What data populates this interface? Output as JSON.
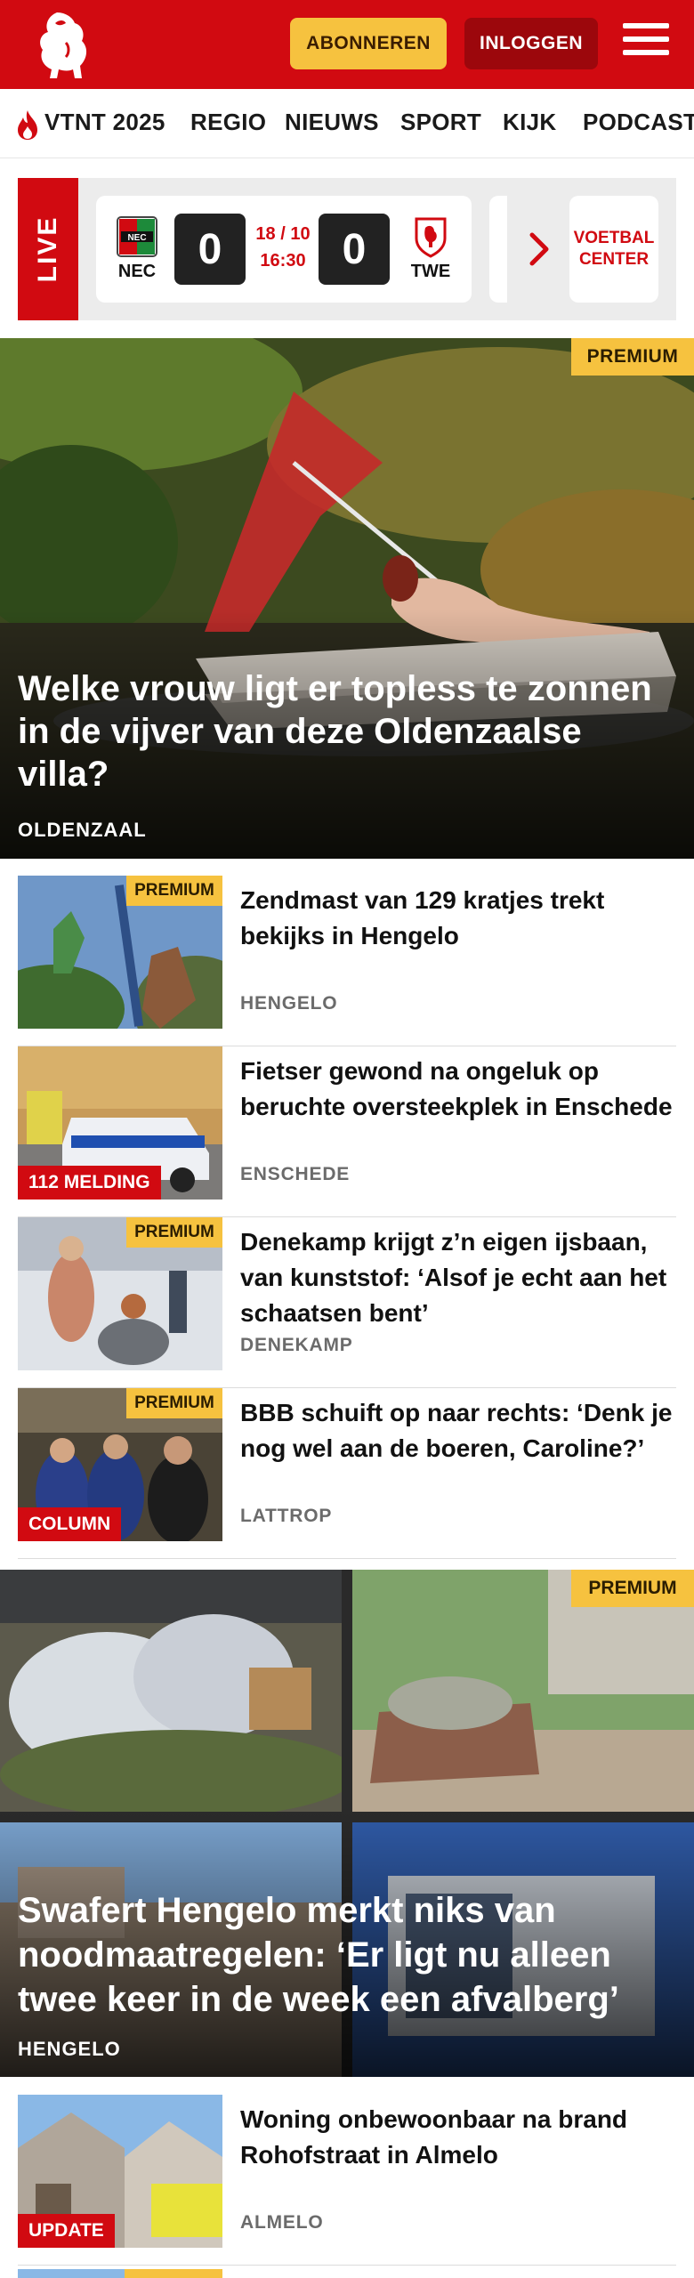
{
  "header": {
    "subscribe_label": "ABONNEREN",
    "login_label": "INLOGGEN",
    "brand_color": "#d10a11",
    "accent_color": "#f6c23f"
  },
  "nav": {
    "items": [
      "VTNT 2025",
      "REGIO",
      "NIEUWS",
      "SPORT",
      "KIJK",
      "PODCAST"
    ]
  },
  "live": {
    "label": "LIVE",
    "match": {
      "home": "NEC",
      "away": "TWE",
      "home_score": "0",
      "away_score": "0",
      "date": "18 / 10",
      "time": "16:30"
    },
    "voetbal_center_label": "VOETBAL CENTER"
  },
  "hero": {
    "badge": "PREMIUM",
    "title": "Welke vrouw ligt er topless te zonnen in de vijver van deze Oldenzaalse villa?",
    "location": "OLDENZAAL"
  },
  "articles": [
    {
      "title": "Zendmast van 129 kratjes trekt bekijks in Hengelo",
      "location": "HENGELO",
      "premium": "PREMIUM",
      "tag": ""
    },
    {
      "title": "Fietser gewond na ongeluk op beruchte oversteekplek in Enschede",
      "location": "ENSCHEDE",
      "premium": "",
      "tag": "112 MELDING"
    },
    {
      "title": "Denekamp krijgt z’n eigen ijsbaan, van kunststof: ‘Alsof je echt aan het schaatsen bent’",
      "location": "DENEKAMP",
      "premium": "PREMIUM",
      "tag": ""
    },
    {
      "title": "BBB schuift op naar rechts: ‘Denk je nog wel aan de boeren, Caroline?’",
      "location": "LATTROP",
      "premium": "PREMIUM",
      "tag": "COLUMN"
    }
  ],
  "double_hero": {
    "badge": "PREMIUM",
    "title": "Swafert Hengelo merkt niks van noodmaatregelen: ‘Er ligt nu alleen twee keer in de week een afvalberg’",
    "location": "HENGELO"
  },
  "article_after": {
    "title": "Woning onbewoonbaar na brand Rohofstraat in Almelo",
    "location": "ALMELO",
    "tag": "UPDATE"
  }
}
